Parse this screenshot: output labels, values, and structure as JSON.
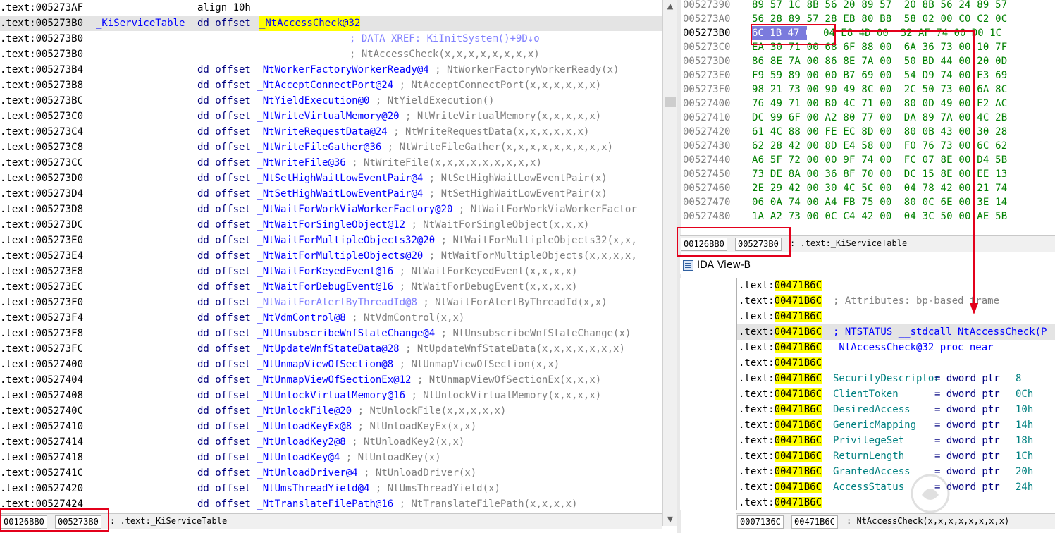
{
  "left_listing": {
    "rows": [
      {
        "addr": ".text:005273AF",
        "mid": "align 10h",
        "kind": "align"
      },
      {
        "addr": ".text:005273B0",
        "label": "_KiServiceTable",
        "directive": "dd offset",
        "sym": "_NtAccessCheck@32",
        "kind": "head"
      },
      {
        "addr": ".text:005273B0",
        "comment": "; DATA XREF: KiInitSystem()+9D↓o",
        "kind": "xref"
      },
      {
        "addr": ".text:005273B0",
        "comment": "; NtAccessCheck(x,x,x,x,x,x,x,x)",
        "kind": "comment"
      },
      {
        "addr": ".text:005273B4",
        "directive": "dd offset",
        "sym": "_NtWorkerFactoryWorkerReady@4",
        "comment": "; NtWorkerFactoryWorkerReady(x)"
      },
      {
        "addr": ".text:005273B8",
        "directive": "dd offset",
        "sym": "_NtAcceptConnectPort@24",
        "comment": "; NtAcceptConnectPort(x,x,x,x,x,x)"
      },
      {
        "addr": ".text:005273BC",
        "directive": "dd offset",
        "sym": "_NtYieldExecution@0",
        "comment": "; NtYieldExecution()"
      },
      {
        "addr": ".text:005273C0",
        "directive": "dd offset",
        "sym": "_NtWriteVirtualMemory@20",
        "comment": "; NtWriteVirtualMemory(x,x,x,x,x)"
      },
      {
        "addr": ".text:005273C4",
        "directive": "dd offset",
        "sym": "_NtWriteRequestData@24",
        "comment": "; NtWriteRequestData(x,x,x,x,x,x)"
      },
      {
        "addr": ".text:005273C8",
        "directive": "dd offset",
        "sym": "_NtWriteFileGather@36",
        "comment": "; NtWriteFileGather(x,x,x,x,x,x,x,x,x)"
      },
      {
        "addr": ".text:005273CC",
        "directive": "dd offset",
        "sym": "_NtWriteFile@36",
        "comment": "; NtWriteFile(x,x,x,x,x,x,x,x,x)"
      },
      {
        "addr": ".text:005273D0",
        "directive": "dd offset",
        "sym": "_NtSetHighWaitLowEventPair@4",
        "comment": "; NtSetHighWaitLowEventPair(x)"
      },
      {
        "addr": ".text:005273D4",
        "directive": "dd offset",
        "sym": "_NtSetHighWaitLowEventPair@4",
        "comment": "; NtSetHighWaitLowEventPair(x)"
      },
      {
        "addr": ".text:005273D8",
        "directive": "dd offset",
        "sym": "_NtWaitForWorkViaWorkerFactory@20",
        "comment": "; NtWaitForWorkViaWorkerFactor"
      },
      {
        "addr": ".text:005273DC",
        "directive": "dd offset",
        "sym": "_NtWaitForSingleObject@12",
        "comment": "; NtWaitForSingleObject(x,x,x)"
      },
      {
        "addr": ".text:005273E0",
        "directive": "dd offset",
        "sym": "_NtWaitForMultipleObjects32@20",
        "comment": "; NtWaitForMultipleObjects32(x,x,"
      },
      {
        "addr": ".text:005273E4",
        "directive": "dd offset",
        "sym": "_NtWaitForMultipleObjects@20",
        "comment": "; NtWaitForMultipleObjects(x,x,x,x,"
      },
      {
        "addr": ".text:005273E8",
        "directive": "dd offset",
        "sym": "_NtWaitForKeyedEvent@16",
        "comment": "; NtWaitForKeyedEvent(x,x,x,x)"
      },
      {
        "addr": ".text:005273EC",
        "directive": "dd offset",
        "sym": "_NtWaitForDebugEvent@16",
        "comment": "; NtWaitForDebugEvent(x,x,x,x)"
      },
      {
        "addr": ".text:005273F0",
        "directive": "dd offset",
        "sym": "_NtWaitForAlertByThreadId@8",
        "comment": "; NtWaitForAlertByThreadId(x,x)",
        "light": true
      },
      {
        "addr": ".text:005273F4",
        "directive": "dd offset",
        "sym": "_NtVdmControl@8",
        "comment": "; NtVdmControl(x,x)"
      },
      {
        "addr": ".text:005273F8",
        "directive": "dd offset",
        "sym": "_NtUnsubscribeWnfStateChange@4",
        "comment": "; NtUnsubscribeWnfStateChange(x)"
      },
      {
        "addr": ".text:005273FC",
        "directive": "dd offset",
        "sym": "_NtUpdateWnfStateData@28",
        "comment": "; NtUpdateWnfStateData(x,x,x,x,x,x,x)"
      },
      {
        "addr": ".text:00527400",
        "directive": "dd offset",
        "sym": "_NtUnmapViewOfSection@8",
        "comment": "; NtUnmapViewOfSection(x,x)"
      },
      {
        "addr": ".text:00527404",
        "directive": "dd offset",
        "sym": "_NtUnmapViewOfSectionEx@12",
        "comment": "; NtUnmapViewOfSectionEx(x,x,x)"
      },
      {
        "addr": ".text:00527408",
        "directive": "dd offset",
        "sym": "_NtUnlockVirtualMemory@16",
        "comment": "; NtUnlockVirtualMemory(x,x,x,x)"
      },
      {
        "addr": ".text:0052740C",
        "directive": "dd offset",
        "sym": "_NtUnlockFile@20",
        "comment": "; NtUnlockFile(x,x,x,x,x)"
      },
      {
        "addr": ".text:00527410",
        "directive": "dd offset",
        "sym": "_NtUnloadKeyEx@8",
        "comment": "; NtUnloadKeyEx(x,x)"
      },
      {
        "addr": ".text:00527414",
        "directive": "dd offset",
        "sym": "_NtUnloadKey2@8",
        "comment": "; NtUnloadKey2(x,x)"
      },
      {
        "addr": ".text:00527418",
        "directive": "dd offset",
        "sym": "_NtUnloadKey@4",
        "comment": "; NtUnloadKey(x)"
      },
      {
        "addr": ".text:0052741C",
        "directive": "dd offset",
        "sym": "_NtUnloadDriver@4",
        "comment": "; NtUnloadDriver(x)"
      },
      {
        "addr": ".text:00527420",
        "directive": "dd offset",
        "sym": "_NtUmsThreadYield@4",
        "comment": "; NtUmsThreadYield(x)"
      },
      {
        "addr": ".text:00527424",
        "directive": "dd offset",
        "sym": "_NtTranslateFilePath@16",
        "comment": "; NtTranslateFilePath(x,x,x,x)"
      }
    ],
    "status": {
      "offset": "00126BB0",
      "address": "005273B0",
      "text": ": .text:_KiServiceTable"
    }
  },
  "hex_view": {
    "rows": [
      {
        "addr": "00527390",
        "bytes": "89 57 1C 8B 56 20 89 57  20 8B 56 24 89 57"
      },
      {
        "addr": "005273A0",
        "bytes": "56 28 89 57 28 EB 80 B8  58 02 00 C0 C2 0C"
      },
      {
        "addr": "005273B0",
        "selected": "6C 1B 47 00",
        "bytes": " 04 E8 4D 00  32 AF 74 00 D0 1C",
        "current": true
      },
      {
        "addr": "005273C0",
        "bytes": "EA 30 71 00 68 6F 88 00  6A 36 73 00 10 7F"
      },
      {
        "addr": "005273D0",
        "bytes": "86 8E 7A 00 86 8E 7A 00  50 BD 44 00 20 0D"
      },
      {
        "addr": "005273E0",
        "bytes": "F9 59 89 00 00 B7 69 00  54 D9 74 00 E3 69"
      },
      {
        "addr": "005273F0",
        "bytes": "98 21 73 00 90 49 8C 00  2C 50 73 00 6A 8C"
      },
      {
        "addr": "00527400",
        "bytes": "76 49 71 00 B0 4C 71 00  80 0D 49 00 E2 AC"
      },
      {
        "addr": "00527410",
        "bytes": "DC 99 6F 00 A2 80 77 00  DA 89 7A 00 4C 2B"
      },
      {
        "addr": "00527420",
        "bytes": "61 4C 88 00 FE EC 8D 00  80 0B 43 00 30 28"
      },
      {
        "addr": "00527430",
        "bytes": "62 28 42 00 8D E4 58 00  F0 76 73 00 6C 62"
      },
      {
        "addr": "00527440",
        "bytes": "A6 5F 72 00 00 9F 74 00  FC 07 8E 00 D4 5B"
      },
      {
        "addr": "00527450",
        "bytes": "73 DE 8A 00 36 8F 70 00  DC 15 8E 00 EE 13"
      },
      {
        "addr": "00527460",
        "bytes": "2E 29 42 00 30 4C 5C 00  04 78 42 00 21 74"
      },
      {
        "addr": "00527470",
        "bytes": "06 0A 74 00 A4 FB 75 00  80 0C 6E 00 3E 14"
      },
      {
        "addr": "00527480",
        "bytes": "1A A2 73 00 0C C4 42 00  04 3C 50 00 AE 5B"
      }
    ],
    "status": {
      "offset": "00126BB0",
      "address": "005273B0",
      "text": ": .text:_KiServiceTable"
    }
  },
  "idab": {
    "title": "IDA View-B",
    "seg": ".text:",
    "addr": "00471B6C",
    "rows": [
      {
        "content": ""
      },
      {
        "content": "; Attributes: bp-based frame",
        "kind": "comment"
      },
      {
        "content": ""
      },
      {
        "content": "; NTSTATUS __stdcall NtAccessCheck(P",
        "kind": "proto"
      },
      {
        "content": "_NtAccessCheck@32 proc near",
        "kind": "proc"
      },
      {
        "content": ""
      },
      {
        "name": "SecurityDescriptor",
        "eq": "= dword ptr",
        "val": "8",
        "kind": "arg"
      },
      {
        "name": "ClientToken",
        "eq": "= dword ptr",
        "val": "0Ch",
        "kind": "arg"
      },
      {
        "name": "DesiredAccess",
        "eq": "= dword ptr",
        "val": "10h",
        "kind": "arg"
      },
      {
        "name": "GenericMapping",
        "eq": "= dword ptr",
        "val": "14h",
        "kind": "arg"
      },
      {
        "name": "PrivilegeSet",
        "eq": "= dword ptr",
        "val": "18h",
        "kind": "arg"
      },
      {
        "name": "ReturnLength",
        "eq": "= dword ptr",
        "val": "1Ch",
        "kind": "arg"
      },
      {
        "name": "GrantedAccess",
        "eq": "= dword ptr",
        "val": "20h",
        "kind": "arg"
      },
      {
        "name": "AccessStatus",
        "eq": "= dword ptr",
        "val": "24h",
        "kind": "arg"
      },
      {
        "content": ""
      }
    ],
    "status": {
      "offset": "0007136C",
      "address": "00471B6C",
      "text": ": NtAccessCheck(x,x,x,x,x,x,x,x)"
    }
  },
  "colors": {
    "annotation_red": "#e3001b",
    "selection_blue": "#7b7bdd",
    "highlight_yellow": "#ffff00",
    "hex_green": "#008000"
  },
  "scrollbar": {
    "up_icon": "▲",
    "down_icon": "▼"
  }
}
